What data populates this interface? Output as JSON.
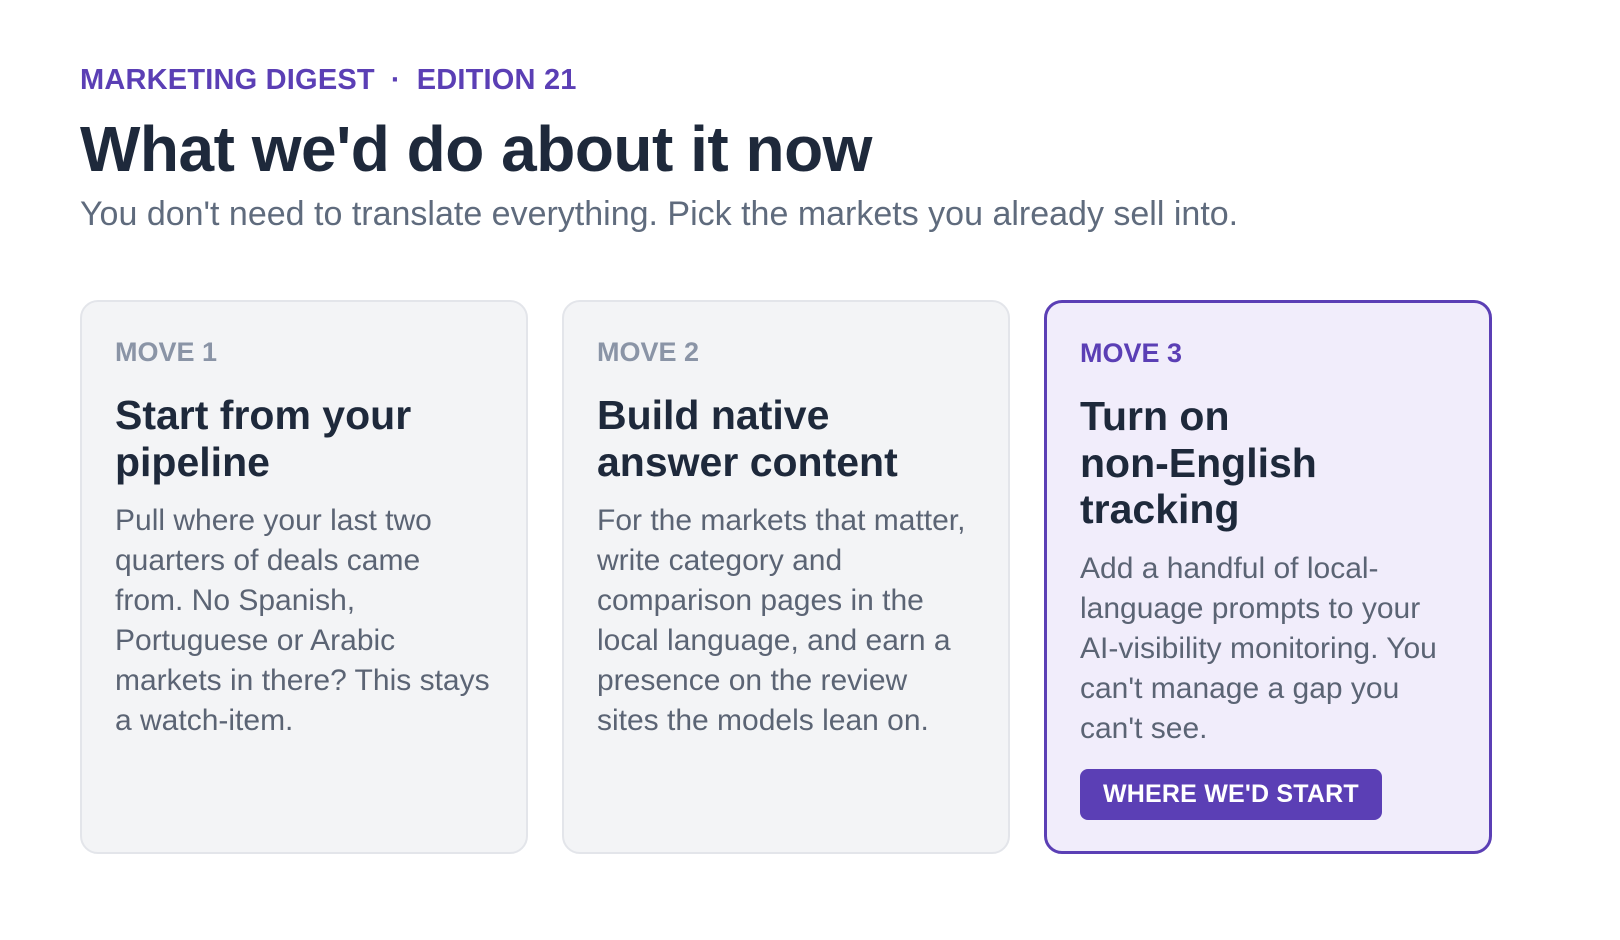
{
  "header": {
    "publication": "MARKETING DIGEST",
    "separator": "·",
    "edition": "EDITION 21",
    "title": "What we'd do about it now",
    "subtitle": "You don't need to translate everything. Pick the markets you already sell into."
  },
  "cards": [
    {
      "move": "MOVE 1",
      "title_line1": "Start from your",
      "title_line2": "pipeline",
      "body": "Pull where your last two quarters of deals came from. No Spanish, Portuguese or Arabic markets in there? This stays a watch-item."
    },
    {
      "move": "MOVE 2",
      "title_line1": "Build native",
      "title_line2": "answer content",
      "body": "For the markets that matter, write category and comparison pages in the local language, and earn a presence on the review sites the models lean on."
    },
    {
      "move": "MOVE 3",
      "title_line1": "Turn on",
      "title_line2": "non-English",
      "title_line3": "tracking",
      "body": "Add a handful of local-language prompts to your AI-visibility monitoring. You can't manage a gap you can't see.",
      "cta": "WHERE WE'D START"
    }
  ],
  "colors": {
    "accent": "#5b3fb5",
    "headline": "#1e293b",
    "muted": "#5f6b7d",
    "card_bg": "#f3f4f6",
    "highlight_bg": "#f1edfb"
  }
}
